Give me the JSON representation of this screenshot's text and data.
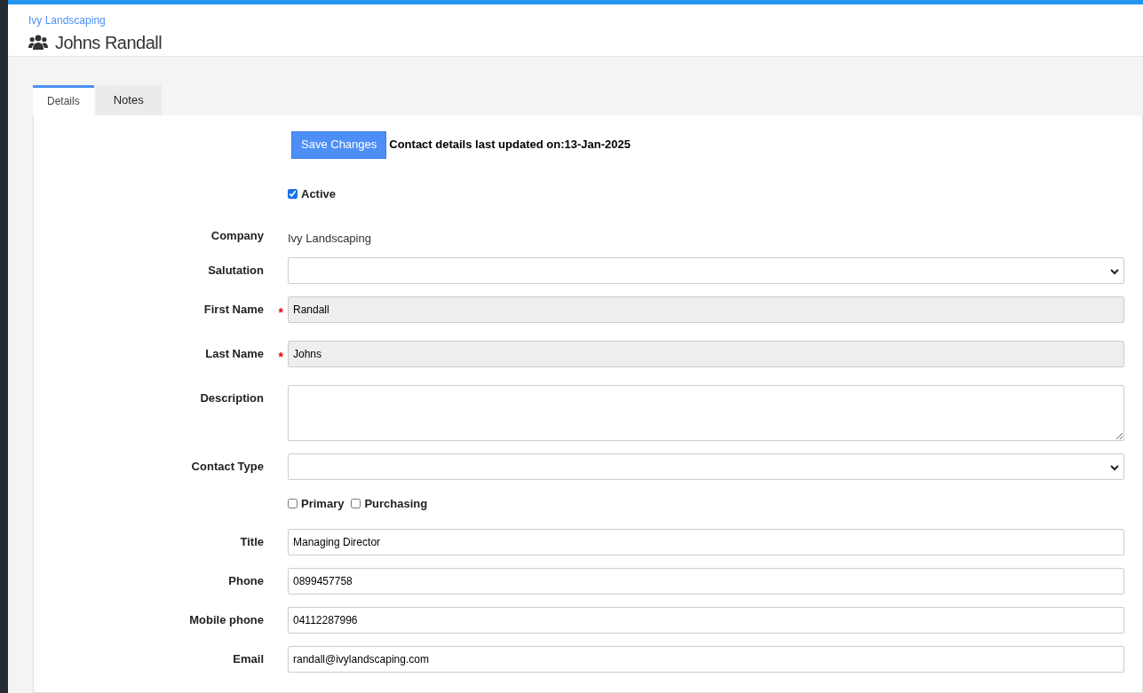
{
  "header": {
    "breadcrumb": "Ivy Landscaping",
    "title": "Johns Randall"
  },
  "tabs": [
    {
      "label": "Details",
      "selected": true
    },
    {
      "label": "Notes",
      "selected": false
    }
  ],
  "toolbar": {
    "save_button": "Save Changes",
    "last_updated": "Contact details last updated on:13-Jan-2025"
  },
  "active": {
    "label": "Active",
    "checked": true
  },
  "fields": [
    {
      "kind": "static",
      "label": "Company",
      "value": "Ivy Landscaping"
    },
    {
      "kind": "select",
      "label": "Salutation"
    },
    {
      "kind": "text",
      "label": "First Name",
      "required_mark": "*",
      "readonly": true,
      "value": "Randall"
    },
    {
      "kind": "text",
      "label": "Last Name",
      "required_mark": "*",
      "readonly": true,
      "value": "Johns"
    },
    {
      "kind": "textarea",
      "label": "Description"
    },
    {
      "kind": "select",
      "label": "Contact Type"
    },
    {
      "kind": "checkboxes",
      "options": [
        {
          "label": "Primary",
          "checked": false
        },
        {
          "label": "Purchasing",
          "checked": false
        }
      ]
    },
    {
      "kind": "text",
      "label": "Title",
      "readonly": false,
      "value": "Managing Director"
    },
    {
      "kind": "text",
      "label": "Phone",
      "readonly": false,
      "value": "0899457758"
    },
    {
      "kind": "text",
      "label": "Mobile phone",
      "readonly": false,
      "value": "04112287996"
    },
    {
      "kind": "text",
      "label": "Email",
      "readonly": false,
      "value": "randall@ivylandscaping.com"
    }
  ]
}
